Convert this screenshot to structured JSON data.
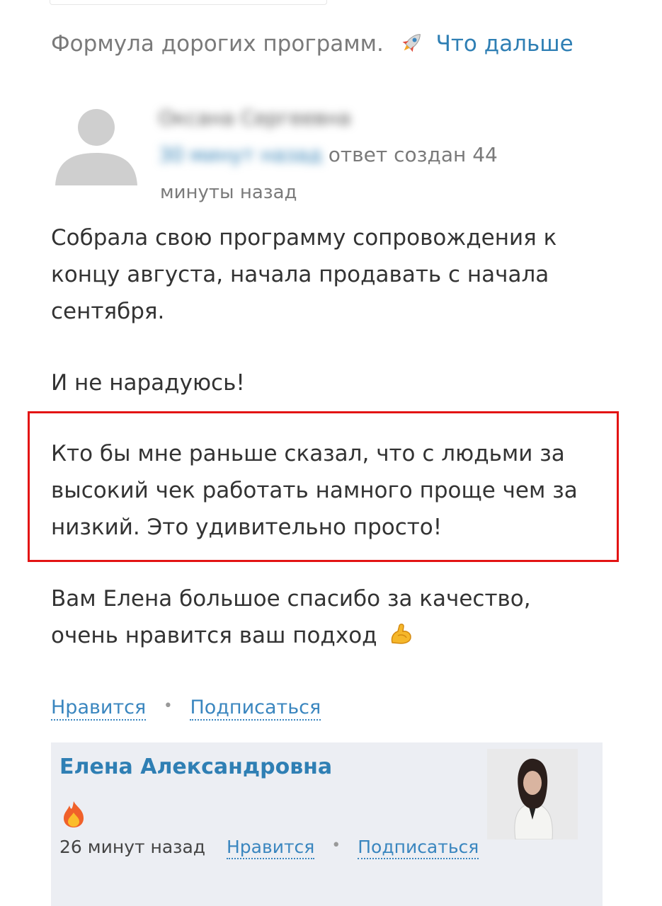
{
  "colors": {
    "link": "#2f7fb4",
    "highlight": "#e31414",
    "card_bg": "#eceef3"
  },
  "previous_snippet": {
    "text": "Формула дорогих программ.",
    "emoji": "🚀",
    "link_label": "Что дальше"
  },
  "comment": {
    "author_name": "Оксана Сергеевна",
    "answer_prefix": "ответ создан 44",
    "time_label": "минуты назад",
    "paragraphs": [
      "Собрала свою программу сопровождения к концу августа, начала продавать с начала сентября.",
      "И не нарадуюсь!",
      "Кто бы мне раньше сказал, что с людьми за высокий чек работать намного проще чем за низкий. Это удивительно просто!",
      "Вам Елена большое спасибо за качество, очень нравится ваш подход"
    ],
    "final_emoji": "flexed-biceps-icon",
    "like_label": "Нравится",
    "subscribe_label": "Подписаться"
  },
  "reply": {
    "author_name": "Елена Александровна",
    "emoji": "fire-icon",
    "time": "26 минут назад",
    "like_label": "Нравится",
    "subscribe_label": "Подписаться"
  }
}
